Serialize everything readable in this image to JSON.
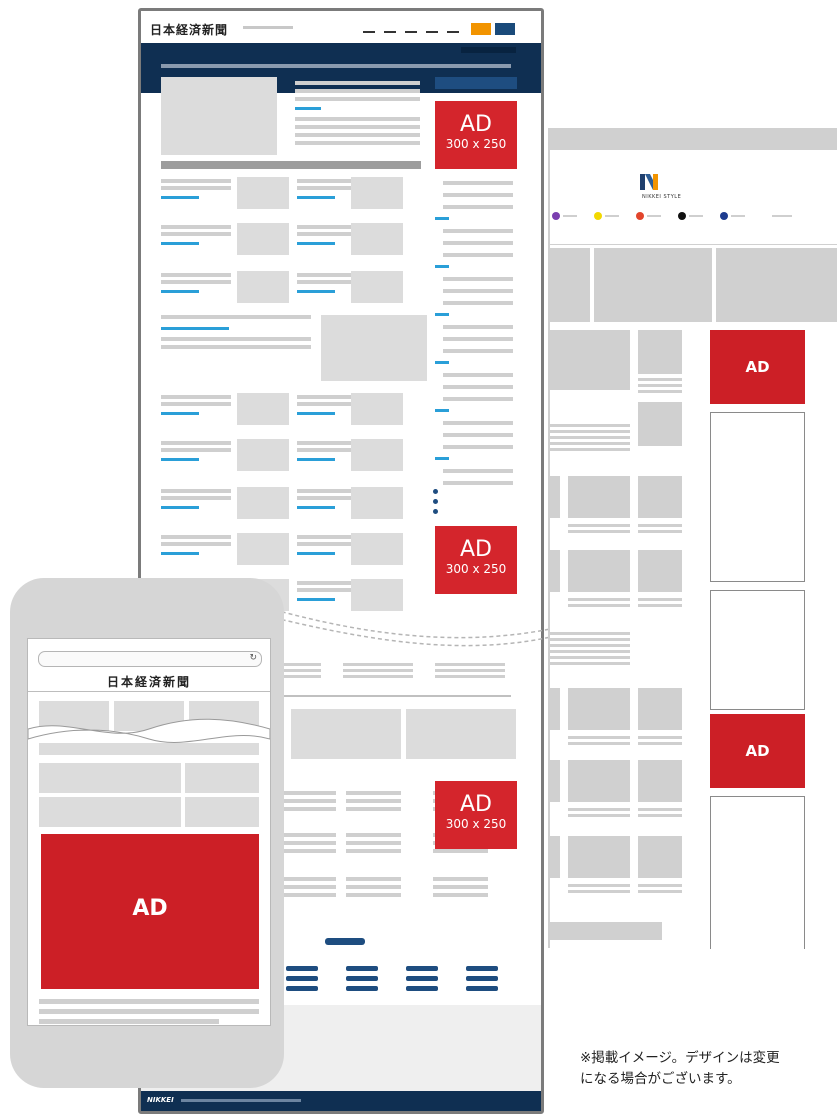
{
  "desktop": {
    "logo": "日本経済新聞",
    "ads": [
      {
        "label": "AD",
        "size": "300 x 250"
      },
      {
        "label": "AD",
        "size": "300 x 250"
      },
      {
        "label": "AD",
        "size": "300 x 250"
      }
    ],
    "footer_logo": "NIKKEI"
  },
  "nikkei_style": {
    "logo_text": "NIKKEI STYLE",
    "menu_dot_colors": [
      "#7b3fb0",
      "#f2d800",
      "#e2452c",
      "#111111",
      "#1d3c8f"
    ],
    "ads": [
      {
        "label": "AD"
      },
      {
        "label": "AD"
      }
    ]
  },
  "phone": {
    "logo": "日本経済新聞",
    "ad_label": "AD"
  },
  "note": {
    "line1": "※掲載イメージ。デザインは変更",
    "line2": "になる場合がございます。"
  },
  "colors": {
    "navy": "#0f2f52",
    "ad_red": "#d4252c",
    "link_blue": "#2a9fd8",
    "orange": "#f29400"
  }
}
